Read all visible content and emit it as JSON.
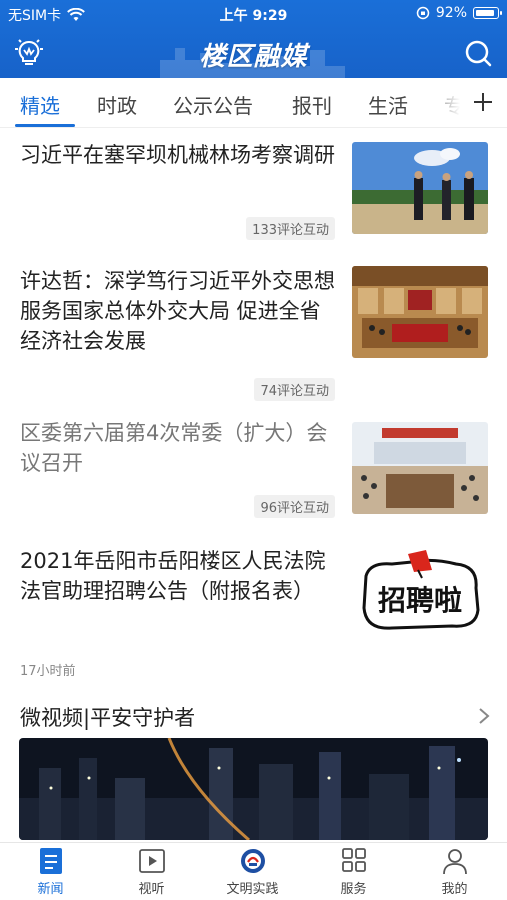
{
  "status_bar": {
    "carrier": "无SIM卡",
    "time": "上午 9:29",
    "battery": "92%",
    "battery_level": 0.92
  },
  "app_bar": {
    "title": "楼区融媒",
    "left_icon": "lightbulb-icon",
    "right_icon": "search-icon"
  },
  "tabs": {
    "items": [
      "精选",
      "时政",
      "公示公告",
      "报刊",
      "生活",
      "专"
    ],
    "active_index": 0,
    "add_icon": "plus-icon"
  },
  "news": [
    {
      "title": "习近平在塞罕坝机械林场考察调研",
      "badge": "133评论互动",
      "thumb": "photo-officials-forest",
      "read": false
    },
    {
      "title": "许达哲：深学笃行习近平外交思想 服务国家总体外交大局 促进全省经济社会发展",
      "badge": "74评论互动",
      "thumb": "photo-conference-hall",
      "read": false
    },
    {
      "title": "区委第六届第4次常委（扩大）会议召开",
      "badge": "96评论互动",
      "thumb": "photo-meeting-room",
      "read": true
    },
    {
      "title": "2021年岳阳市岳阳楼区人民法院法官助理招聘公告（附报名表）",
      "thumb": "logo-zhaopinla",
      "thumb_text": "招聘啦",
      "time": "17小时前",
      "read": false
    }
  ],
  "section": {
    "label": "微视频|平安守护者",
    "icon": "chevron-right-icon",
    "video_thumb": "photo-city-night"
  },
  "bottom_nav": {
    "items": [
      {
        "label": "新闻",
        "icon": "news-icon"
      },
      {
        "label": "视听",
        "icon": "video-icon"
      },
      {
        "label": "文明实践",
        "icon": "civilization-icon"
      },
      {
        "label": "服务",
        "icon": "grid-icon"
      },
      {
        "label": "我的",
        "icon": "profile-icon"
      }
    ],
    "active_index": 0
  },
  "colors": {
    "brand_blue": "#1a6fd8",
    "text_primary": "#222222",
    "text_read": "#777777"
  }
}
